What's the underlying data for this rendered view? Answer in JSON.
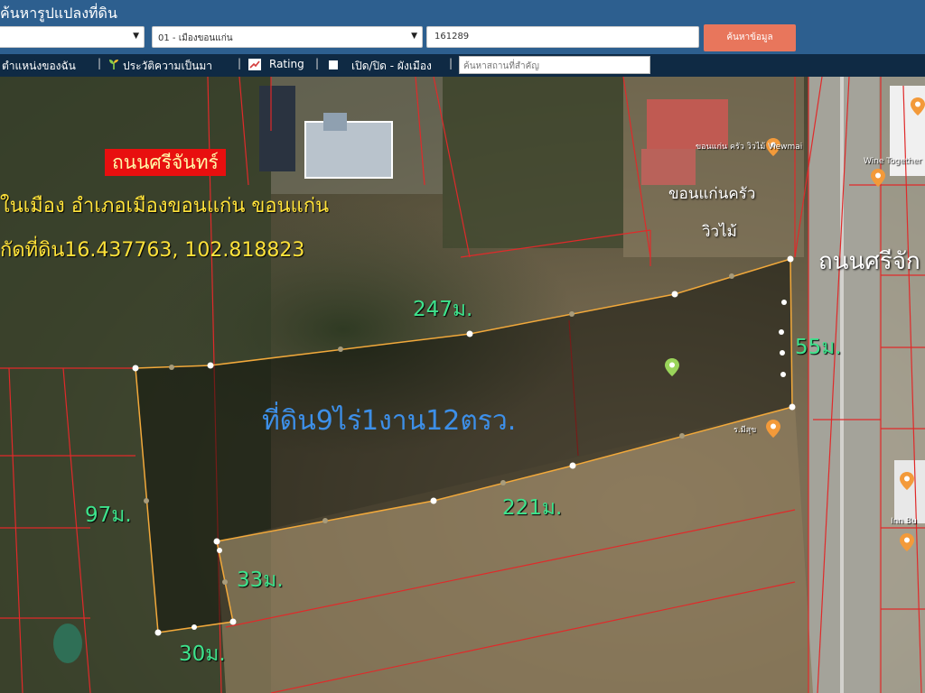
{
  "header": {
    "title": "ค้นหารูปแปลงที่ดิน",
    "district_select": "01 - เมืองขอนแก่น",
    "parcel_number": "161289",
    "search_button": "ค้นหาข้อมูล"
  },
  "toolbar": {
    "my_location": "ตำแหน่งของฉัน",
    "history": "ประวัติความเป็นมา",
    "rating": "Rating",
    "toggle_layer": "เปิด/ปิด - ผังเมือง",
    "search_placeholder": "ค้นหาสถานที่สำคัญ"
  },
  "map": {
    "road_label": "ถนนศรีจันทร์",
    "address": "ในเมือง อำเภอเมืองขอนแก่น ขอนแก่น",
    "coordinates": "กัดที่ดิน16.437763, 102.818823",
    "area_label": "ที่ดิน9ไร่1งาน12ตรว.",
    "dimensions": {
      "top": "247ม.",
      "right": "55ม.",
      "bottom": "221ม.",
      "left": "97ม.",
      "inner_edge": "33ม.",
      "bottom_left": "30ม."
    },
    "restaurant_label": "ขอนแก่นครัว วิวไม้",
    "restaurant_line1": "ขอนแก่นครัว",
    "restaurant_line2": "วิวไม้",
    "road_right": "ถนนศรีจัก",
    "poi_viewmai": "ขอนแก่น ครัว วิวไม้ Viewmai",
    "poi_wine": "Wine Together",
    "poi_inn": "Inn Bu",
    "poi_small": "ร.มีสุข"
  },
  "colors": {
    "header_bg": "#2d5f8f",
    "toolbar_bg": "#0f2a44",
    "search_button": "#e8765c",
    "boundary": "#f2a93b",
    "parcel_lines": "#e02a2a",
    "dimension_text": "#3ee38c",
    "area_text": "#3d8fe8",
    "road_label_bg": "#e80f0f"
  }
}
